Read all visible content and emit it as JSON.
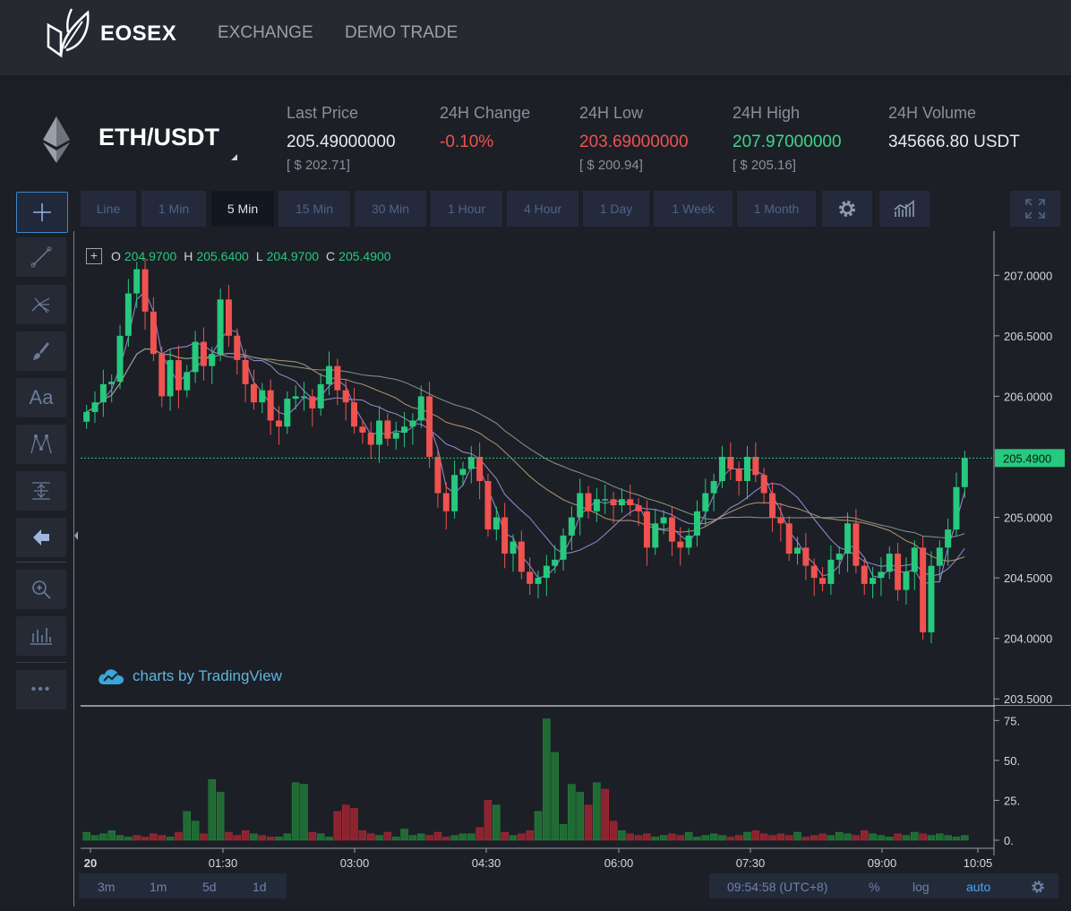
{
  "brand": {
    "name": "EOSEX"
  },
  "nav": {
    "exchange": "EXCHANGE",
    "demo": "DEMO TRADE"
  },
  "ticker": {
    "pair": "ETH/USDT",
    "last_price": {
      "label": "Last Price",
      "value": "205.49000000",
      "usd": "[ $ 202.71]"
    },
    "change": {
      "label": "24H Change",
      "value": "-0.10%"
    },
    "low": {
      "label": "24H Low",
      "value": "203.69000000",
      "usd": "[ $ 200.94]"
    },
    "high": {
      "label": "24H High",
      "value": "207.97000000",
      "usd": "[ $ 205.16]"
    },
    "volume": {
      "label": "24H Volume",
      "value": "345666.80 USDT"
    }
  },
  "timeframes": [
    "Line",
    "1 Min",
    "5 Min",
    "15 Min",
    "30 Min",
    "1 Hour",
    "4 Hour",
    "1 Day",
    "1 Week",
    "1 Month"
  ],
  "timeframe_active": "5 Min",
  "tools": [
    "crosshair-icon",
    "trend-line-icon",
    "pitchfork-icon",
    "brush-icon",
    "text-icon",
    "pattern-icon",
    "measure-icon",
    "arrow-left-icon",
    "zoom-in-icon",
    "bars-ruler-icon",
    "more-icon"
  ],
  "tools_text": {
    "text_tool": "Aa",
    "more": "•••"
  },
  "ohlc": {
    "o_label": "O",
    "o": "204.9700",
    "h_label": "H",
    "h": "205.6400",
    "l_label": "L",
    "l": "204.9700",
    "c_label": "C",
    "c": "205.4900"
  },
  "watermark": "charts by TradingView",
  "bottom": {
    "ranges": [
      "3m",
      "1m",
      "5d",
      "1d"
    ],
    "clock": "09:54:58 (UTC+8)",
    "percent": "%",
    "log": "log",
    "auto": "auto"
  },
  "colors": {
    "up": "#26c97d",
    "down": "#f0524f",
    "accent": "#3f86c8",
    "ma_purple": "#9c8fd8",
    "ma_tan": "#b89a72",
    "ma_gray": "#8b9a8a"
  },
  "chart_data": {
    "type": "candlestick",
    "price_axis": {
      "ticks": [
        "207.0000",
        "206.5000",
        "206.0000",
        "205.0000",
        "204.5000",
        "204.0000",
        "203.5000"
      ],
      "range": [
        203.45,
        207.35
      ]
    },
    "current_price": "205.4900",
    "time_axis": {
      "ticks": [
        "20",
        "01:30",
        "03:00",
        "04:30",
        "06:00",
        "07:30",
        "09:00",
        "10:05"
      ]
    },
    "volume_axis": {
      "ticks": [
        "75.",
        "50.",
        "25.",
        "0."
      ],
      "range": [
        0,
        78
      ]
    },
    "close": [
      205.87,
      205.95,
      206.1,
      206.12,
      206.5,
      206.85,
      207.05,
      206.7,
      206.35,
      206.0,
      206.3,
      206.05,
      206.2,
      206.45,
      206.25,
      206.35,
      206.8,
      206.5,
      206.3,
      206.1,
      205.95,
      206.05,
      205.8,
      205.75,
      205.98,
      206.0,
      206.0,
      205.9,
      206.1,
      206.25,
      206.05,
      205.95,
      205.75,
      205.7,
      205.6,
      205.8,
      205.65,
      205.7,
      205.75,
      205.8,
      206.0,
      205.5,
      205.2,
      205.05,
      205.35,
      205.4,
      205.5,
      205.3,
      204.9,
      205.0,
      204.7,
      204.8,
      204.55,
      204.45,
      204.5,
      204.6,
      204.65,
      204.85,
      205.0,
      205.2,
      205.05,
      205.15,
      205.15,
      205.1,
      205.15,
      205.1,
      205.05,
      204.75,
      204.95,
      205.0,
      204.8,
      204.75,
      204.85,
      205.05,
      205.2,
      205.3,
      205.5,
      205.4,
      205.3,
      205.5,
      205.35,
      205.2,
      205.0,
      204.95,
      204.7,
      204.75,
      204.6,
      204.5,
      204.45,
      204.65,
      204.7,
      204.95,
      204.6,
      204.45,
      204.5,
      204.55,
      204.7,
      204.4,
      204.55,
      204.75,
      204.05,
      204.6,
      204.75,
      204.9,
      205.25,
      205.49
    ],
    "volume": [
      5,
      3,
      4,
      6,
      3,
      2,
      3,
      2,
      4,
      3,
      2,
      5,
      18,
      12,
      4,
      38,
      30,
      5,
      3,
      6,
      4,
      3,
      2,
      2,
      4,
      36,
      35,
      5,
      4,
      2,
      18,
      22,
      20,
      6,
      4,
      3,
      5,
      2,
      7,
      3,
      4,
      3,
      5,
      2,
      3,
      4,
      4,
      8,
      25,
      22,
      5,
      3,
      4,
      6,
      18,
      76,
      55,
      10,
      35,
      30,
      22,
      36,
      32,
      12,
      6,
      4,
      3,
      4,
      2,
      3,
      4,
      3,
      5,
      2,
      3,
      4,
      3,
      2,
      3,
      5,
      6,
      4,
      3,
      4,
      3,
      5,
      2,
      3,
      4,
      3,
      5,
      4,
      3,
      6,
      4,
      3,
      2,
      4,
      3,
      5,
      4,
      3,
      4,
      3,
      2,
      3
    ],
    "volume_up_flags": [
      1,
      1,
      1,
      1,
      1,
      1,
      0,
      0,
      0,
      0,
      1,
      0,
      1,
      1,
      0,
      1,
      1,
      0,
      0,
      0,
      1,
      0,
      0,
      1,
      1,
      1,
      1,
      0,
      1,
      1,
      0,
      0,
      0,
      0,
      0,
      1,
      0,
      1,
      1,
      1,
      1,
      0,
      0,
      0,
      1,
      1,
      1,
      0,
      0,
      1,
      0,
      1,
      0,
      0,
      1,
      1,
      1,
      1,
      1,
      1,
      0,
      1,
      0,
      0,
      1,
      0,
      0,
      0,
      1,
      1,
      0,
      0,
      1,
      1,
      1,
      1,
      1,
      0,
      0,
      1,
      0,
      0,
      0,
      0,
      0,
      1,
      0,
      0,
      0,
      1,
      1,
      1,
      0,
      0,
      1,
      1,
      1,
      0,
      1,
      1,
      0,
      1,
      1,
      1,
      1,
      1
    ]
  }
}
